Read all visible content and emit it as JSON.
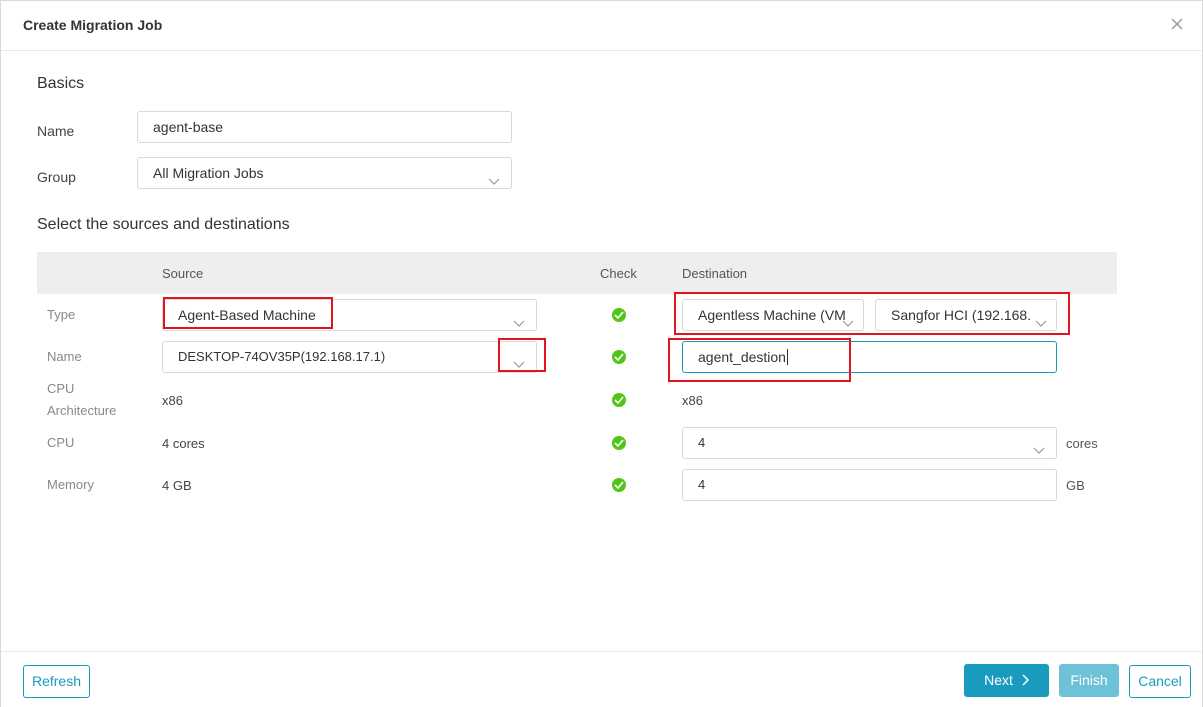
{
  "dialog": {
    "title": "Create Migration Job",
    "close_icon": "close-icon"
  },
  "basics": {
    "heading": "Basics",
    "name_label": "Name",
    "name_value": "agent-base",
    "group_label": "Group",
    "group_value": "All Migration Jobs"
  },
  "mapping": {
    "heading": "Select the sources and destinations",
    "columns": {
      "source": "Source",
      "check": "Check",
      "destination": "Destination"
    },
    "rows": {
      "type": {
        "label": "Type",
        "source": "Agent-Based Machine",
        "destination_type": "Agentless Machine (VM",
        "destination_platform": "Sangfor HCI  (192.168."
      },
      "name": {
        "label": "Name",
        "source": "DESKTOP-74OV35P(192.168.17.1)",
        "destination": "agent_destion"
      },
      "cpu_arch": {
        "label_line1": "CPU",
        "label_line2": "Architecture",
        "source": "x86",
        "destination": "x86"
      },
      "cpu": {
        "label": "CPU",
        "source": "4 cores",
        "destination": "4",
        "unit": "cores"
      },
      "memory": {
        "label": "Memory",
        "source": "4 GB",
        "destination": "4",
        "unit": "GB"
      }
    }
  },
  "footer": {
    "refresh": "Refresh",
    "next": "Next",
    "finish": "Finish",
    "cancel": "Cancel"
  },
  "colors": {
    "accent": "#1a9bbd",
    "check_ok": "#52c41a",
    "highlight": "#e0141e"
  }
}
